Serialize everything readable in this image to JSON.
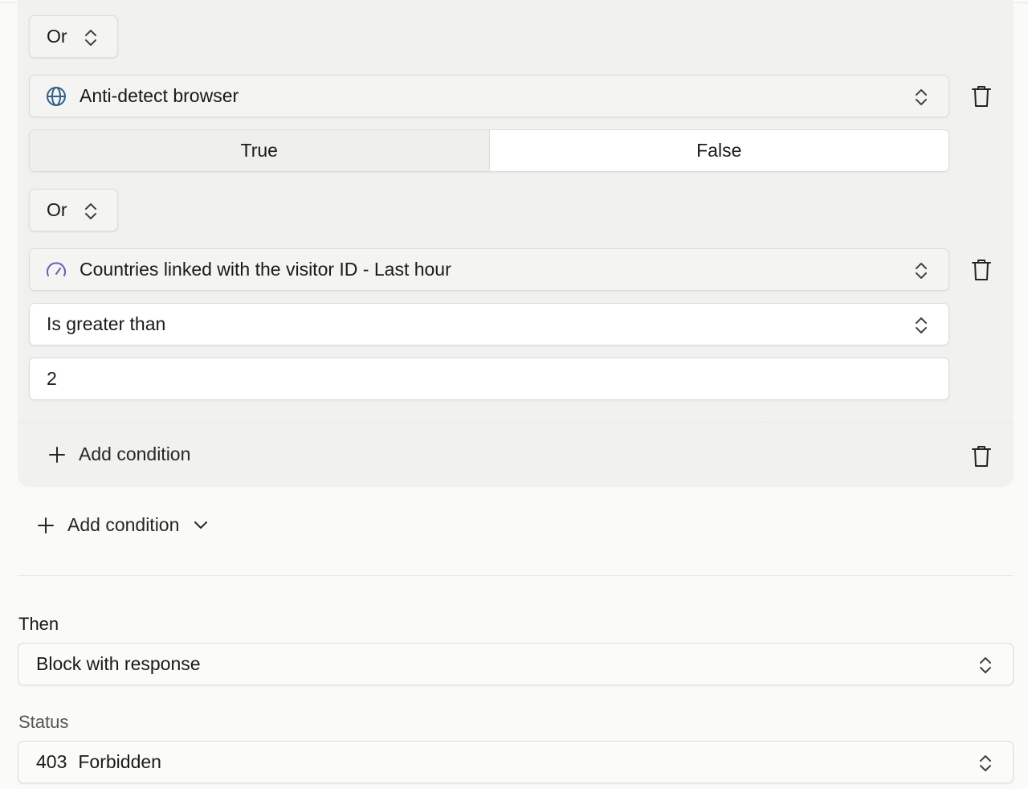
{
  "conditions": {
    "operator_1": "Or",
    "condition_1": {
      "field": "Anti-detect browser",
      "field_icon": "globe-icon",
      "options": {
        "true_label": "True",
        "false_label": "False"
      },
      "selected": "False"
    },
    "operator_2": "Or",
    "condition_2": {
      "field": "Countries linked with the visitor ID - Last hour",
      "field_icon": "gauge-icon",
      "comparator": "Is greater than",
      "value": "2"
    },
    "inner_add_condition_label": "Add condition",
    "outer_add_condition_label": "Add condition"
  },
  "then": {
    "label": "Then",
    "action": "Block with response"
  },
  "status": {
    "label": "Status",
    "code": "403",
    "text": "Forbidden"
  },
  "colors": {
    "globe_icon": "#2f5f8a",
    "gauge_icon": "#6b5fb0",
    "group_background": "#f1f1ef",
    "selected_segment": "#ffffff"
  }
}
